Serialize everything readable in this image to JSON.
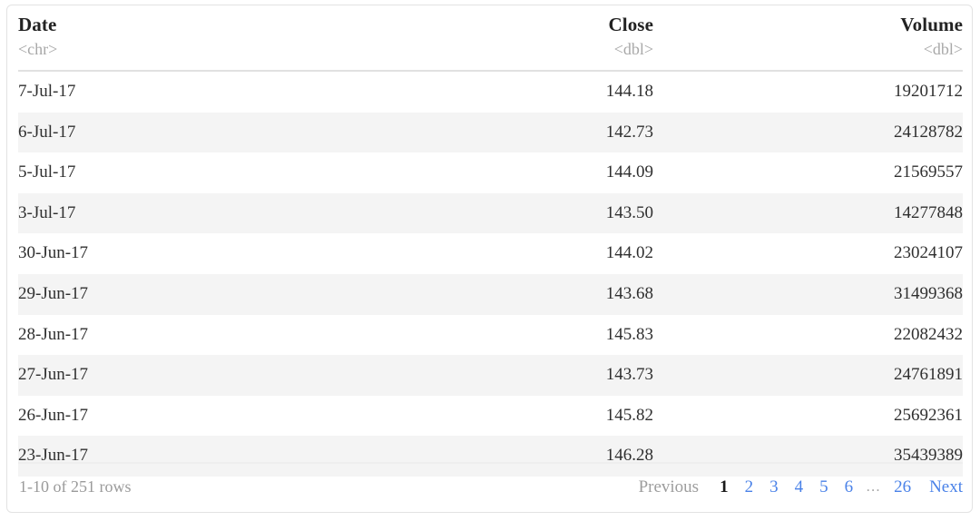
{
  "table": {
    "columns": [
      {
        "label": "Date",
        "type": "<chr>",
        "align": "left"
      },
      {
        "label": "Close",
        "type": "<dbl>",
        "align": "right"
      },
      {
        "label": "Volume",
        "type": "<dbl>",
        "align": "right"
      }
    ],
    "rows": [
      {
        "date": "7-Jul-17",
        "close": "144.18",
        "volume": "19201712"
      },
      {
        "date": "6-Jul-17",
        "close": "142.73",
        "volume": "24128782"
      },
      {
        "date": "5-Jul-17",
        "close": "144.09",
        "volume": "21569557"
      },
      {
        "date": "3-Jul-17",
        "close": "143.50",
        "volume": "14277848"
      },
      {
        "date": "30-Jun-17",
        "close": "144.02",
        "volume": "23024107"
      },
      {
        "date": "29-Jun-17",
        "close": "143.68",
        "volume": "31499368"
      },
      {
        "date": "28-Jun-17",
        "close": "145.83",
        "volume": "22082432"
      },
      {
        "date": "27-Jun-17",
        "close": "143.73",
        "volume": "24761891"
      },
      {
        "date": "26-Jun-17",
        "close": "145.82",
        "volume": "25692361"
      },
      {
        "date": "23-Jun-17",
        "close": "146.28",
        "volume": "35439389"
      }
    ]
  },
  "footer": {
    "rows_summary": "1-10 of 251 rows",
    "pagination": {
      "previous_label": "Previous",
      "next_label": "Next",
      "ellipsis": "…",
      "current_page": "1",
      "pages": [
        "1",
        "2",
        "3",
        "4",
        "5",
        "6"
      ],
      "last_page": "26"
    }
  },
  "colors": {
    "link": "#4a82e8",
    "muted": "#9a9a9a",
    "stripe": "#f4f4f4",
    "border": "#e3e3e3",
    "text": "#2f2f2f"
  }
}
